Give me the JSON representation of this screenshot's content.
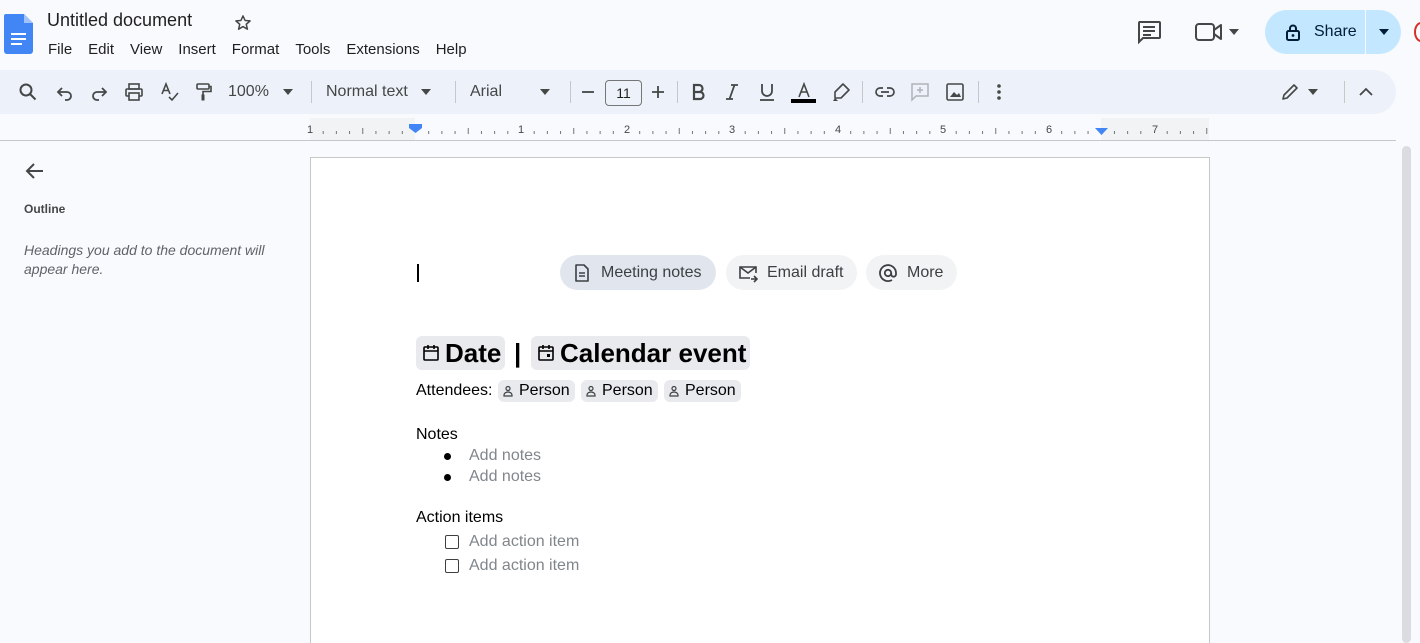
{
  "document": {
    "title": "Untitled document"
  },
  "menu": [
    "File",
    "Edit",
    "View",
    "Insert",
    "Format",
    "Tools",
    "Extensions",
    "Help"
  ],
  "share": {
    "label": "Share"
  },
  "toolbar": {
    "zoom": "100%",
    "style": "Normal text",
    "font": "Arial",
    "font_size": "11",
    "text_color": "#000000"
  },
  "ruler": {
    "labels": [
      "1",
      "1",
      "2",
      "3",
      "4",
      "5",
      "6",
      "7"
    ]
  },
  "outline": {
    "title": "Outline",
    "hint": "Headings you add to the document will appear here."
  },
  "templates": {
    "meeting_notes": "Meeting notes",
    "email_draft": "Email draft",
    "more": "More"
  },
  "meeting": {
    "date": "Date",
    "separator": "|",
    "calendar_event": "Calendar event",
    "attendees_label": "Attendees:",
    "attendees": [
      "Person",
      "Person",
      "Person"
    ],
    "notes_label": "Notes",
    "notes": [
      "Add notes",
      "Add notes"
    ],
    "actions_label": "Action items",
    "actions": [
      "Add action item",
      "Add action item"
    ]
  },
  "colors": {
    "share_bg": "#c2e7ff",
    "toolbar_bg": "#edf2fa",
    "docs_blue": "#4285f4",
    "ruler_marker": "#4285f4"
  },
  "icons": {
    "logo": "google-docs-logo",
    "star": "star-outline",
    "comments": "comment-icon",
    "meet": "video-camera-icon",
    "lock": "lock-icon"
  }
}
